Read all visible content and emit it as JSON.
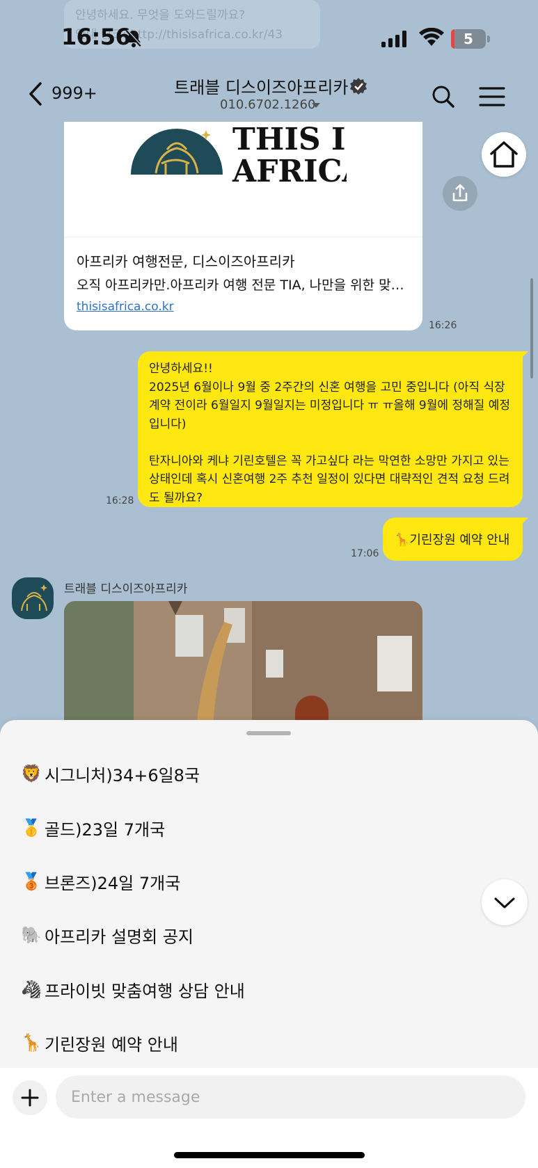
{
  "status_bar": {
    "time": "16:56",
    "battery": "5"
  },
  "background_preview": {
    "line1": "안녕하세요. 무엇을 도와드릴까요?",
    "line2": "안내 링크: http://thisisafrica.co.kr/43"
  },
  "header": {
    "back_count": "999+",
    "title": "트래블 디스이즈아프리카",
    "phone": "010.6702.1260"
  },
  "link_card": {
    "logo_line1": "THIS IS",
    "logo_line2": "AFRICA",
    "title": "아프리카 여행전문, 디스이즈아프리카",
    "description": "오직 아프리카만.아프리카 여행 전문 TIA, 나만을 위한 맞…",
    "url": "thisisafrica.co.kr",
    "time": "16:26"
  },
  "messages": {
    "me1": {
      "text": "안녕하세요!!\n2025년 6월이나 9월 중 2주간의 신혼 여행을 고민 중입니다 (아직 식장 계약 전이라 6월일지 9월일지는 미정입니다 ㅠ ㅠ올해 9월에 정해질 예정입니다)\n\n탄자니아와 케냐 기린호텔은 꼭 가고싶다 라는 막연한 소망만 가지고 있는 상태인데 혹시 신혼여행 2주 추천 일정이 있다면 대략적인 견적 요청 드려도 될까요?",
      "time": "16:28"
    },
    "me2": {
      "text": "🦒기린장원 예약 안내",
      "time": "17:06"
    },
    "other_sender": "트래블 디스이즈아프리카"
  },
  "menu_items": [
    {
      "emoji": "🦁",
      "label": "시그니처)34+6일8국"
    },
    {
      "emoji": "🥇",
      "label": "골드)23일 7개국"
    },
    {
      "emoji": "🥉",
      "label": "브론즈)24일 7개국"
    },
    {
      "emoji": "🐘",
      "label": "아프리카 설명회 공지"
    },
    {
      "emoji": "🦓",
      "label": "프라이빗 맞춤여행 상담 안내"
    },
    {
      "emoji": "🦒",
      "label": "기린장원 예약 안내"
    }
  ],
  "input": {
    "placeholder": "Enter a message"
  }
}
